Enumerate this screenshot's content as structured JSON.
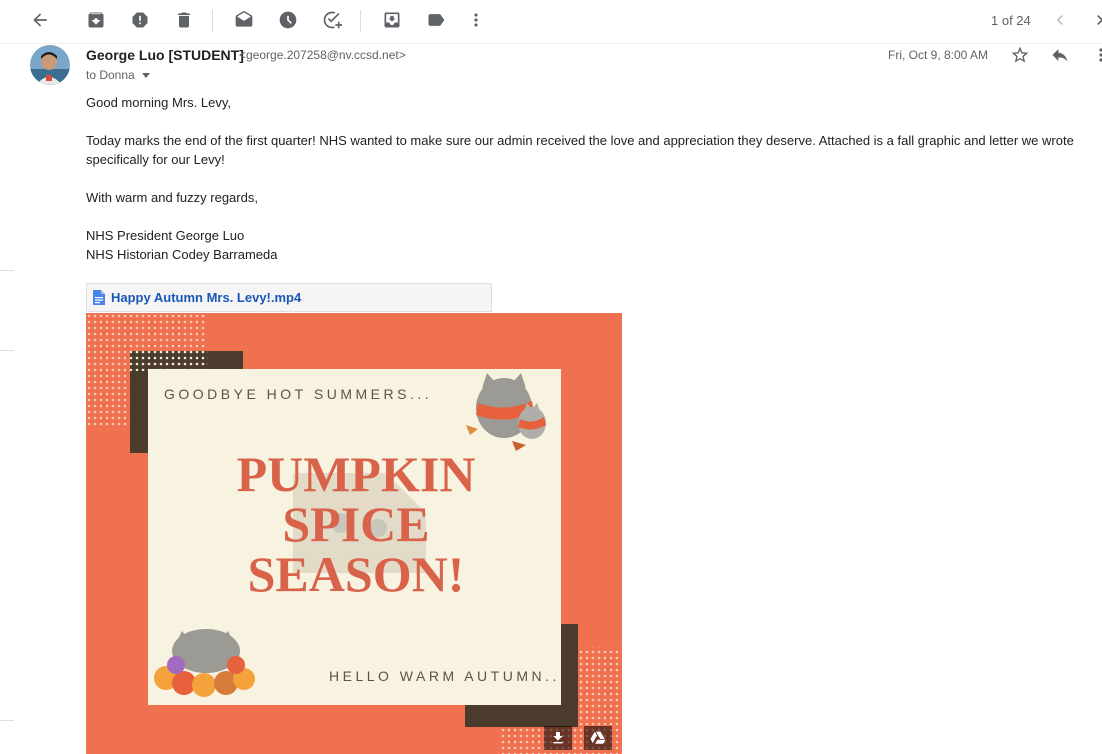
{
  "toolbar": {
    "page_count": "1 of 24",
    "icons": [
      "back-arrow-icon",
      "archive-icon",
      "report-spam-icon",
      "delete-icon",
      "mark-unread-icon",
      "snooze-icon",
      "add-task-icon",
      "move-to-icon",
      "label-icon",
      "more-vert-icon",
      "chevron-left-icon",
      "chevron-right-icon"
    ]
  },
  "message": {
    "sender_name": "George Luo [STUDENT]",
    "sender_email": "<george.207258@nv.ccsd.net>",
    "to_label": "to Donna",
    "date": "Fri, Oct 9, 8:00 AM",
    "body": {
      "greeting": "Good morning Mrs. Levy,",
      "paragraph": "Today marks the end of the first quarter! NHS wanted to make sure our admin received the love and appreciation they deserve. Attached is a fall graphic and letter we wrote specifically for our Levy!",
      "closing": "With warm and fuzzy regards,",
      "signature_line1": "NHS President George Luo",
      "signature_line2": "NHS Historian Codey Barrameda"
    }
  },
  "attachment": {
    "file_name": "Happy Autumn Mrs. Levy!.mp4",
    "graphic": {
      "top_text": "GOODBYE HOT SUMMERS...",
      "title_line1": "PUMPKIN",
      "title_line2": "SPICE",
      "title_line3": "SEASON!",
      "bottom_text": "HELLO WARM AUTUMN..."
    }
  },
  "colors": {
    "accent_link": "#1a56b8",
    "graphic_background": "#ef7150",
    "graphic_card": "#f7f3e0",
    "graphic_title": "#d9634a",
    "graphic_dark_frame": "#4a3b2d"
  }
}
